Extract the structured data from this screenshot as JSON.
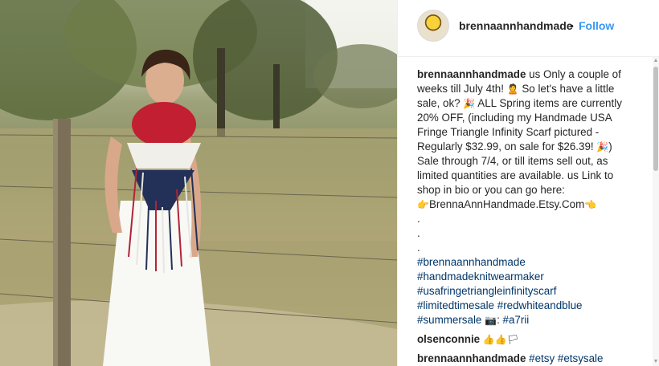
{
  "post": {
    "username": "brennaannhandmade",
    "dot": "•",
    "follow_label": "Follow"
  },
  "caption": {
    "username": "brennaannhandmade",
    "l1": "us Only a couple of",
    "l2a": "weeks till July 4th!",
    "l2b": "So let's have a little",
    "l3a": "sale, ok?",
    "l3b": "ALL Spring items are currently",
    "l4": "20% OFF, (including my Handmade USA",
    "l5": "Fringe Triangle Infinity Scarf pictured -",
    "l6a": "Regularly $32.99, on sale for $26.39!",
    "l6b": ")",
    "l7": "Sale through 7/4, or till items sell out, as",
    "l8": "limited quantities are available. us Link to",
    "l9": "shop in bio or you can go here:",
    "l10": "BrennaAnnHandmade.Etsy.Com",
    "dot": ".",
    "hashtags": [
      "#brennaannhandmade",
      "#handmadeknitwearmaker",
      "#usafringetriangleinfinityscarf"
    ],
    "tag_limited": "#limitedtimesale",
    "tag_rwb": "#redwhiteandblue",
    "tag_summer": "#summersale",
    "camera_sep": ":",
    "tag_a7": "#a7rii"
  },
  "comments": [
    {
      "username": "olsenconnie"
    },
    {
      "username": "brennaannhandmade",
      "tags": "#etsy #etsysale"
    }
  ],
  "icons": {
    "woman_emoji": "🙎",
    "party_emoji": "🎉",
    "point_right_emoji": "👉",
    "point_left_emoji": "👈",
    "camera_emoji": "📷",
    "thumbs_up_emoji": "👍",
    "flag_emoji": "🏳"
  }
}
